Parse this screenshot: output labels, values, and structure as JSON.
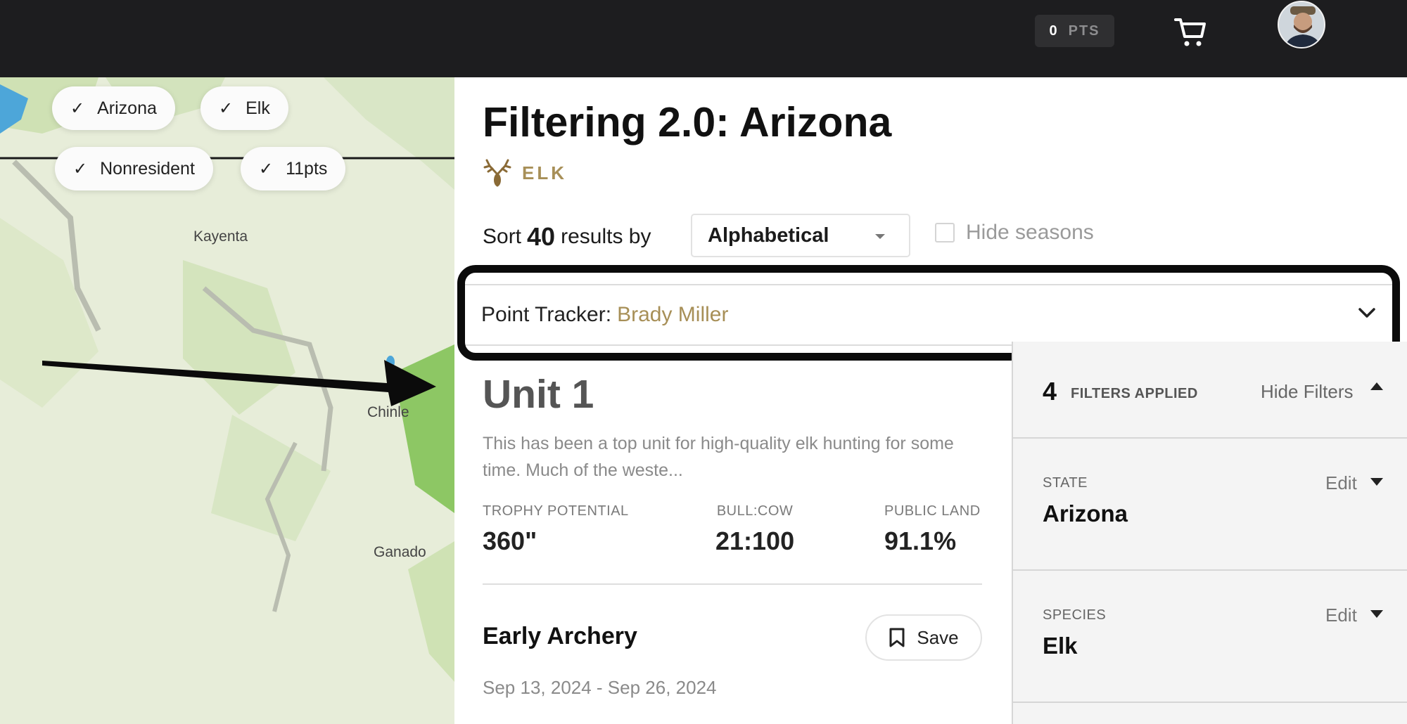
{
  "topbar": {
    "points_value": "0",
    "points_label": "PTS",
    "cart_icon": "cart-icon",
    "avatar_icon": "user-avatar"
  },
  "map": {
    "chips": [
      {
        "label": "Arizona"
      },
      {
        "label": "Elk"
      },
      {
        "label": "Nonresident"
      },
      {
        "label": "11pts"
      }
    ],
    "places": {
      "kayenta": "Kayenta",
      "chinle": "Chinle",
      "ganado": "Ganado"
    }
  },
  "header": {
    "title": "Filtering 2.0: Arizona",
    "species_label": "ELK",
    "species_icon": "elk-antler-icon"
  },
  "sort": {
    "prefix": "Sort",
    "count": "40",
    "suffix": "results by",
    "selected": "Alphabetical",
    "hide_seasons_label": "Hide seasons"
  },
  "tracker": {
    "label": "Point Tracker:",
    "name": "Brady Miller"
  },
  "unit": {
    "title": "Unit 1",
    "description": "This has been a top unit for high-quality elk hunting for some time. Much of the weste...",
    "stats": [
      {
        "label": "TROPHY POTENTIAL",
        "value": "360\""
      },
      {
        "label": "BULL:COW",
        "value": "21:100"
      },
      {
        "label": "PUBLIC LAND",
        "value": "91.1%"
      }
    ],
    "season": {
      "name": "Early Archery",
      "save_label": "Save",
      "dates": "Sep 13, 2024 - Sep 26, 2024"
    }
  },
  "filters": {
    "count": "4",
    "applied_label": "FILTERS APPLIED",
    "hide_label": "Hide Filters",
    "items": [
      {
        "label": "STATE",
        "value": "Arizona",
        "edit_label": "Edit"
      },
      {
        "label": "SPECIES",
        "value": "Elk",
        "edit_label": "Edit"
      }
    ]
  },
  "colors": {
    "topbar": "#1d1d1f",
    "accent_gold": "#a78f57",
    "highlight_border": "#0b0b0b"
  }
}
